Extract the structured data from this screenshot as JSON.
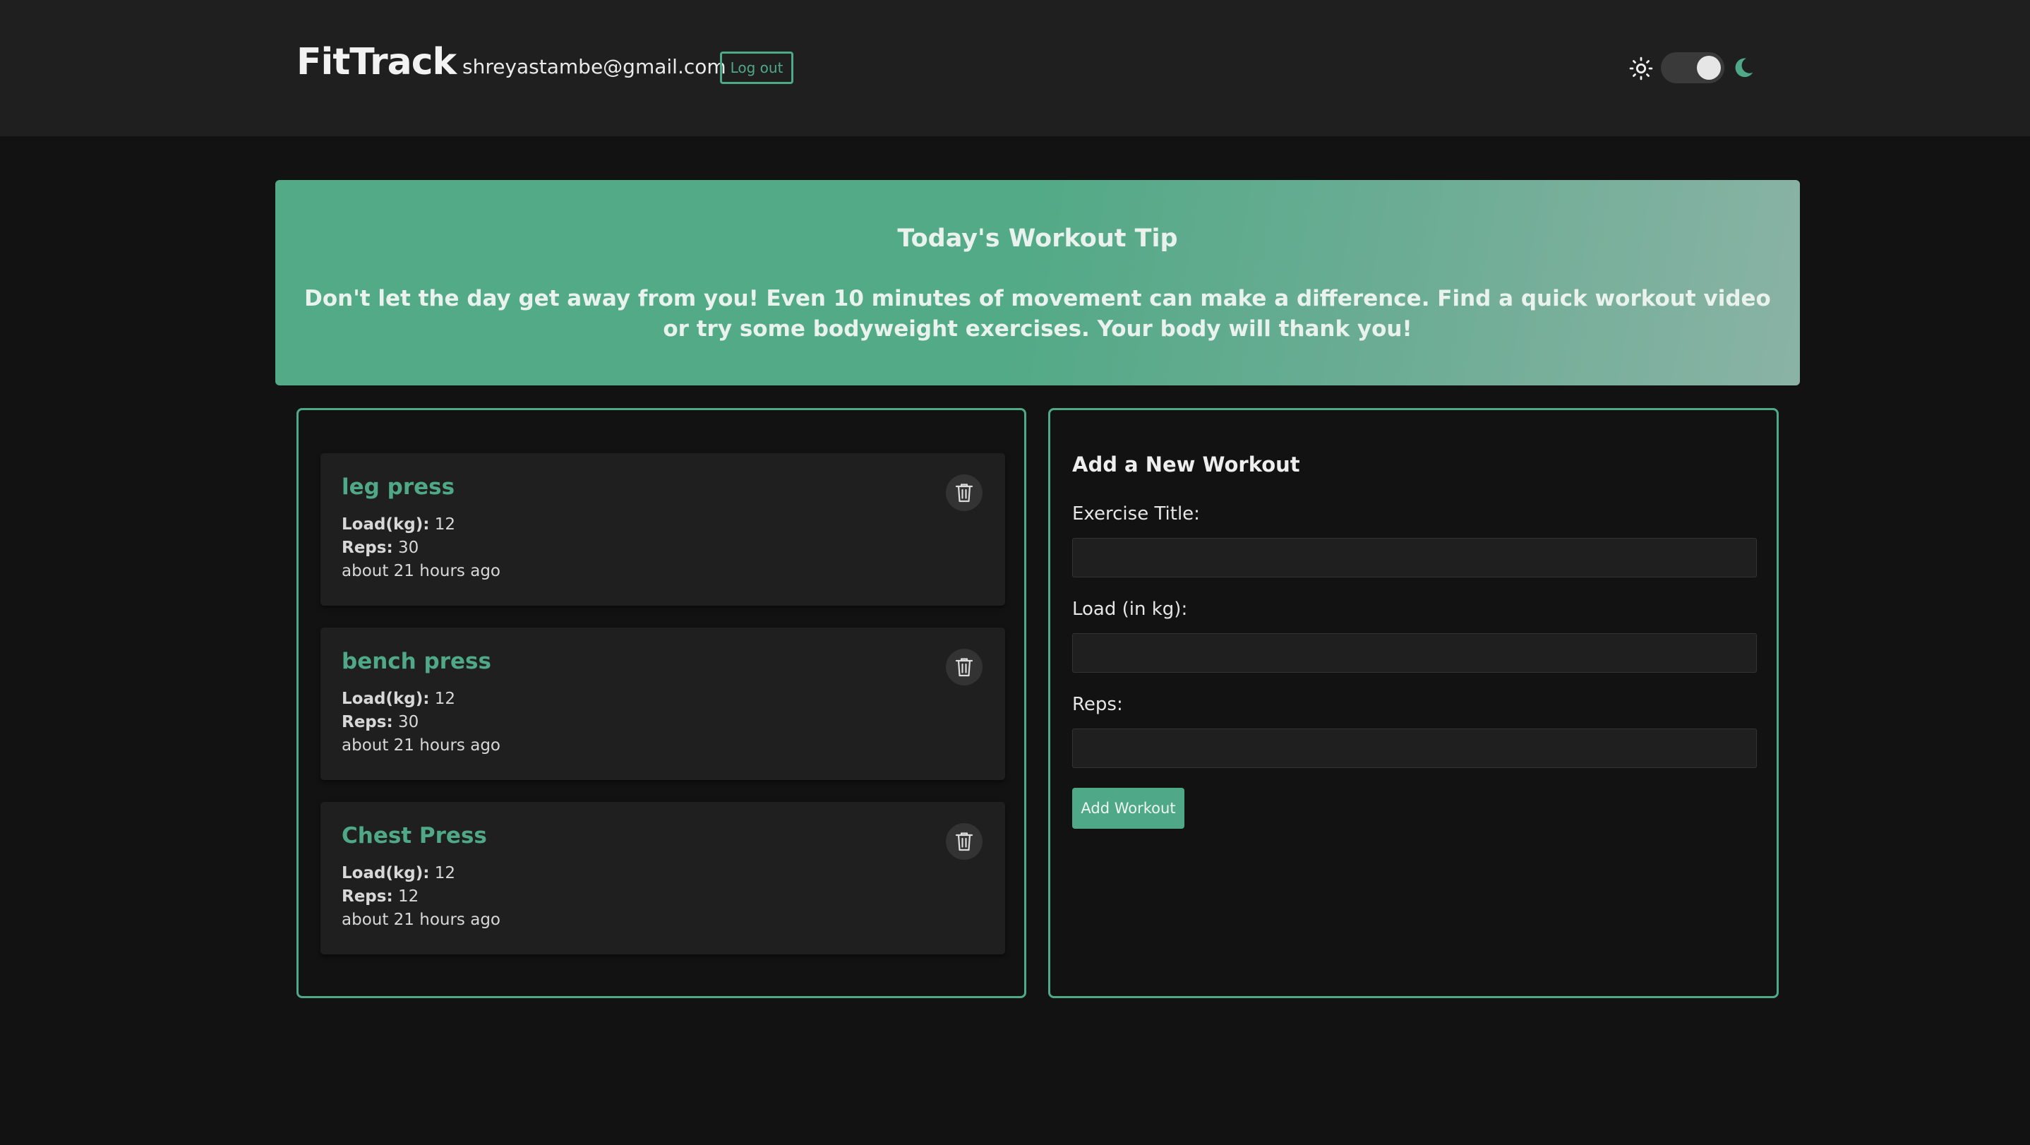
{
  "header": {
    "brand": "FitTrack",
    "user_email": "shreyastambe@gmail.com",
    "logout_label": "Log out",
    "theme": "dark"
  },
  "tip": {
    "title": "Today's Workout Tip",
    "text": "Don't let the day get away from you! Even 10 minutes of movement can make a difference. Find a quick workout video or try some bodyweight exercises. Your body will thank you!"
  },
  "workouts": [
    {
      "title": "leg press",
      "load_label": "Load(kg):",
      "load": "12",
      "reps_label": "Reps:",
      "reps": "30",
      "time": "about 21 hours ago"
    },
    {
      "title": "bench press",
      "load_label": "Load(kg):",
      "load": "12",
      "reps_label": "Reps:",
      "reps": "30",
      "time": "about 21 hours ago"
    },
    {
      "title": "Chest Press",
      "load_label": "Load(kg):",
      "load": "12",
      "reps_label": "Reps:",
      "reps": "12",
      "time": "about 21 hours ago"
    }
  ],
  "form": {
    "title": "Add a New Workout",
    "exercise_label": "Exercise Title:",
    "exercise_value": "",
    "load_label": "Load (in kg):",
    "load_value": "",
    "reps_label": "Reps:",
    "reps_value": "",
    "submit_label": "Add Workout"
  },
  "colors": {
    "accent": "#4fa988",
    "background": "#121212",
    "surface": "#1f1f1f"
  }
}
